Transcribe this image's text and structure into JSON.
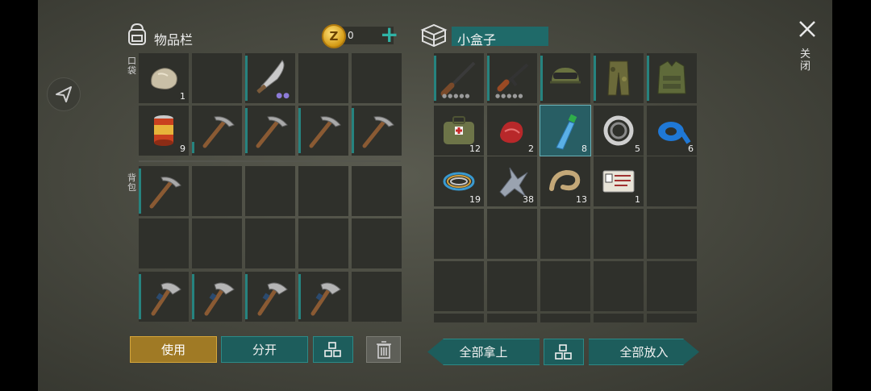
{
  "inventory": {
    "title": "物品栏",
    "coins": "0",
    "pockets_label": "口袋",
    "backpack_label": "背包",
    "slots": {
      "r0c0": "1",
      "r1c0": "9"
    }
  },
  "container": {
    "name": "小盒子",
    "counts": {
      "medkit": "12",
      "meat": "2",
      "water": "8",
      "bearing": "5",
      "tape": "6",
      "wire": "19",
      "scrap": "38",
      "rope": "13",
      "id_card": "1"
    }
  },
  "buttons": {
    "use": "使用",
    "split": "分开",
    "take_all": "全部拿上",
    "put_all": "全部放入",
    "close": "关闭"
  },
  "colors": {
    "accent_teal": "#26837f",
    "use_gold": "#a07a25",
    "selected_slot": "#285e64"
  },
  "icons": [
    "backpack-icon",
    "coin-icon",
    "plus-icon",
    "crate-icon",
    "share-icon",
    "close-icon",
    "sort-icon",
    "trash-icon"
  ]
}
